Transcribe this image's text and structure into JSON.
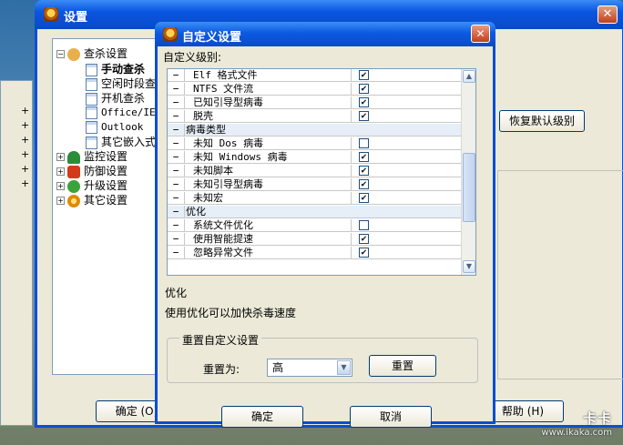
{
  "bg_window": {
    "title": "设置",
    "close_glyph": "✕",
    "tree": {
      "group1": "查杀设置",
      "items": [
        "手动查杀",
        "空闲时段查",
        "开机查杀",
        "Office/IE",
        "Outlook",
        "其它嵌入式"
      ],
      "group2": "监控设置",
      "group3": "防御设置",
      "group4": "升级设置",
      "group5": "其它设置"
    },
    "restore_default_btn": "恢复默认级别",
    "ok_btn": "确定 (O)",
    "help_btn": "帮助 (H)"
  },
  "dialog": {
    "title": "自定义设置",
    "close_glyph": "✕",
    "level_label": "自定义级别:",
    "rows": [
      {
        "type": "item",
        "label": "Elf 格式文件",
        "checked": true
      },
      {
        "type": "item",
        "label": "NTFS 文件流",
        "checked": true
      },
      {
        "type": "item",
        "label": "已知引导型病毒",
        "checked": true
      },
      {
        "type": "item",
        "label": "脱壳",
        "checked": true
      },
      {
        "type": "cat",
        "label": "病毒类型"
      },
      {
        "type": "item",
        "label": "未知 Dos 病毒",
        "checked": false
      },
      {
        "type": "item",
        "label": "未知 Windows 病毒",
        "checked": true
      },
      {
        "type": "item",
        "label": "未知脚本",
        "checked": true
      },
      {
        "type": "item",
        "label": "未知引导型病毒",
        "checked": true
      },
      {
        "type": "item",
        "label": "未知宏",
        "checked": true
      },
      {
        "type": "cat",
        "label": "优化"
      },
      {
        "type": "item",
        "label": "系统文件优化",
        "checked": false
      },
      {
        "type": "item",
        "label": "使用智能提速",
        "checked": true
      },
      {
        "type": "item",
        "label": "忽略异常文件",
        "checked": true
      }
    ],
    "description_title": "优化",
    "description_text": "使用优化可以加快杀毒速度",
    "reset_group_label": "重置自定义设置",
    "reset_to_label": "重置为:",
    "reset_level_value": "高",
    "reset_button": "重置",
    "ok_button": "确定",
    "cancel_button": "取消"
  },
  "watermark": {
    "line1": "卡卡",
    "line2": "www.ikaka.com"
  }
}
